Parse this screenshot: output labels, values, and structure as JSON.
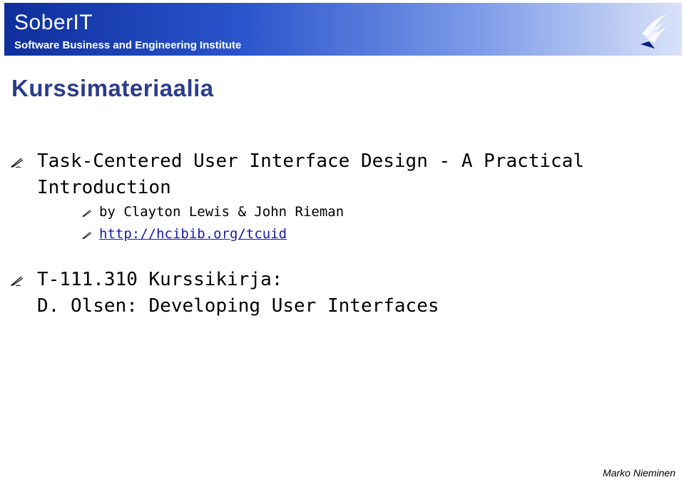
{
  "header": {
    "brand": "SoberIT",
    "subtitle": "Software Business and Engineering Institute",
    "colors": {
      "banner_dark": "#0e2f9c",
      "banner_light": "#d9e2f9"
    },
    "logo_icon": "institute-logo-icon"
  },
  "slide": {
    "title": "Kurssimateriaalia",
    "title_color": "#2c3c8c"
  },
  "bullets": [
    {
      "line1": "Task-Centered User Interface Design - A Practical",
      "line2": "Introduction",
      "sub": [
        {
          "text": "by Clayton Lewis & John Rieman"
        },
        {
          "text": "http://hcibib.org/tcuid"
        }
      ]
    },
    {
      "line1": "T-111.310 Kurssikirja:",
      "line2": "D. Olsen: Developing User Interfaces"
    }
  ],
  "footer": {
    "author": "Marko Nieminen"
  },
  "bullet_icon": "pencil-icon",
  "link_color": "#1a1aa8"
}
